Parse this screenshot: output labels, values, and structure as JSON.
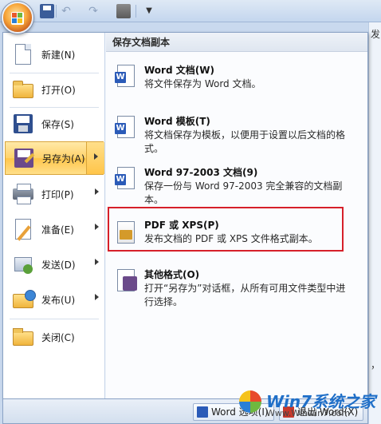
{
  "quick_access": {
    "save_icon": "save-icon",
    "undo_icon": "undo-icon",
    "redo_icon": "redo-icon",
    "print_icon": "print-preview-icon",
    "more_icon": "dropdown-icon"
  },
  "left_menu": {
    "items": [
      {
        "label": "新建(N)",
        "icon": "new-document-icon"
      },
      {
        "label": "打开(O)",
        "icon": "open-folder-icon"
      },
      {
        "label": "保存(S)",
        "icon": "save-icon"
      },
      {
        "label": "另存为(A)",
        "icon": "save-as-icon",
        "active": true
      },
      {
        "label": "打印(P)",
        "icon": "printer-icon"
      },
      {
        "label": "准备(E)",
        "icon": "prepare-icon"
      },
      {
        "label": "发送(D)",
        "icon": "send-icon"
      },
      {
        "label": "发布(U)",
        "icon": "publish-icon"
      },
      {
        "label": "关闭(C)",
        "icon": "close-folder-icon"
      }
    ]
  },
  "right_panel": {
    "title": "保存文档副本",
    "options": [
      {
        "title": "Word 文档(W)",
        "desc": "将文件保存为 Word 文档。",
        "icon": "word-document-icon"
      },
      {
        "title": "Word 模板(T)",
        "desc": "将文档保存为模板，以便用于设置以后文档的格式。",
        "icon": "word-template-icon"
      },
      {
        "title": "Word 97-2003 文档(9)",
        "desc": "保存一份与 Word 97-2003 完全兼容的文档副本。",
        "icon": "word-97-icon"
      },
      {
        "title": "PDF 或 XPS(P)",
        "desc": "发布文档的 PDF 或 XPS 文件格式副本。",
        "icon": "pdf-xps-icon"
      },
      {
        "title": "其他格式(O)",
        "desc": "打开“另存为”对话框，从所有可用文件类型中进行选择。",
        "icon": "other-formats-icon"
      }
    ]
  },
  "bottom_bar": {
    "options_label": "Word 选项(I)",
    "exit_label": "退出 Word(X)"
  },
  "edge_fragments": {
    "top": "发",
    "mid": "，"
  },
  "watermark": {
    "text": "Win7系统之家",
    "sub": "Www.Winwin7.com"
  },
  "colors": {
    "highlight": "#d6202a",
    "active_item": "#ffd26a"
  }
}
